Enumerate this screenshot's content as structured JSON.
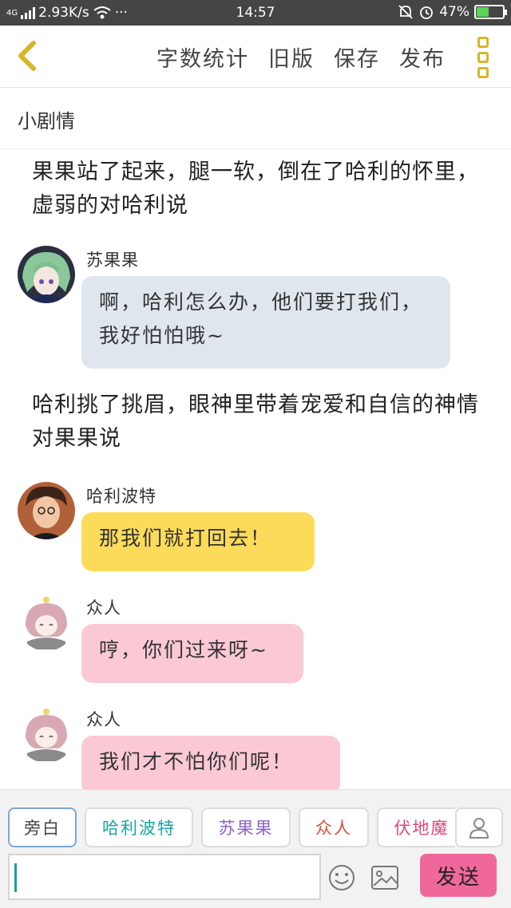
{
  "status_bar": {
    "network": "4G",
    "speed": "2.93K/s",
    "more": "···",
    "time": "14:57",
    "battery": "47%",
    "battery_level": 0.47
  },
  "header": {
    "back_icon": "chevron-left-icon",
    "actions": [
      "字数统计",
      "旧版",
      "保存",
      "发布"
    ],
    "more_icon": "more-vertical-icon",
    "accent_color": "#d8b52a"
  },
  "section": {
    "title": "小剧情"
  },
  "chat": [
    {
      "type": "narration",
      "text": "果果站了起来，腿一软，倒在了哈利的怀里，虚弱的对哈利说"
    },
    {
      "type": "message",
      "sender": "苏果果",
      "text": "啊，哈利怎么办，他们要打我们，我好怕怕哦~",
      "color": "#dfe6ee"
    },
    {
      "type": "narration",
      "text": "哈利挑了挑眉，眼神里带着宠爱和自信的神情对果果说"
    },
    {
      "type": "message",
      "sender": "哈利波特",
      "text": "那我们就打回去！",
      "color": "#fcdb5b"
    },
    {
      "type": "message",
      "sender": "众人",
      "text": "哼，你们过来呀~",
      "color": "#fbc9d4"
    },
    {
      "type": "message",
      "sender": "众人",
      "text": "我们才不怕你们呢！",
      "color": "#fbc9d4"
    }
  ],
  "input_bar": {
    "roles": [
      {
        "label": "旁白",
        "color": "#444444"
      },
      {
        "label": "哈利波特",
        "color": "#1aa6a0"
      },
      {
        "label": "苏果果",
        "color": "#8a64c8"
      },
      {
        "label": "众人",
        "color": "#e04a3a"
      },
      {
        "label": "伏地魔",
        "color": "#e0467e"
      }
    ],
    "user_icon": "user-icon",
    "input_value": "",
    "emoji_icon": "emoji-icon",
    "image_icon": "image-icon",
    "send_label": "发送",
    "send_color": "#f0689b"
  }
}
